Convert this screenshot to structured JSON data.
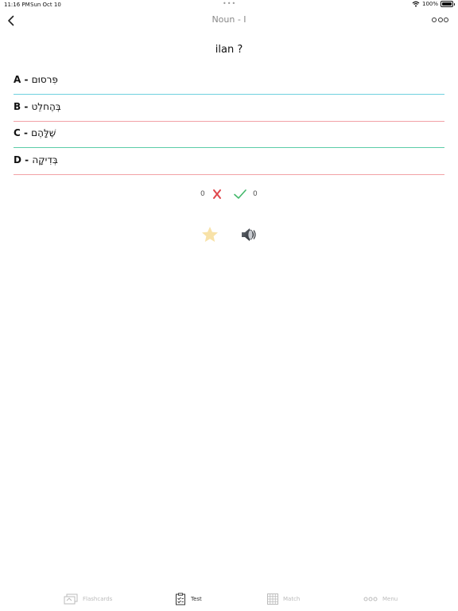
{
  "status": {
    "time": "11:16 PM",
    "date": "Sun Oct 10",
    "battery": "100%"
  },
  "nav": {
    "title": "Noun - I"
  },
  "question": "ilan ?",
  "options": [
    {
      "letter": "A",
      "separator": " - ",
      "text": "פִּרסוּם",
      "line_color": "#6fd0de"
    },
    {
      "letter": "B",
      "separator": " - ",
      "text": "בְּהֶחלֵט",
      "line_color": "#f2a1a6"
    },
    {
      "letter": "C",
      "separator": " - ",
      "text": "שֶׁלָּהֶם",
      "line_color": "#5ccca8"
    },
    {
      "letter": "D",
      "separator": " - ",
      "text": "בְּדִיקָה",
      "line_color": "#f2a1a6"
    }
  ],
  "score": {
    "wrong": "0",
    "right": "0",
    "wrong_color": "#e0474c",
    "right_color": "#43b86b"
  },
  "actions": {
    "star_icon": "star-icon",
    "star_color": "#f8e2a8",
    "speaker_icon": "speaker-icon"
  },
  "tabs": [
    {
      "label": "Flashcards",
      "icon": "flashcards-icon",
      "active": false
    },
    {
      "label": "Test",
      "icon": "test-icon",
      "active": true
    },
    {
      "label": "Match",
      "icon": "match-icon",
      "active": false
    },
    {
      "label": "Menu",
      "icon": "menu-icon",
      "active": false
    }
  ]
}
